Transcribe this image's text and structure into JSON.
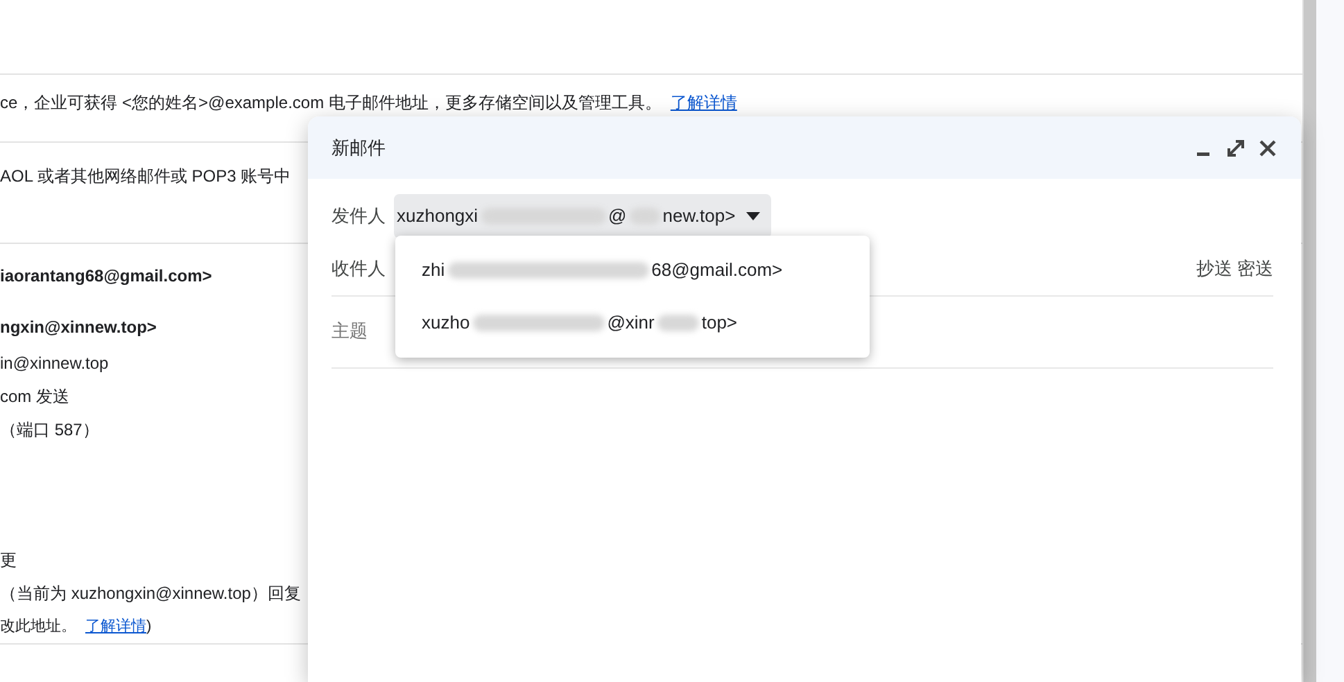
{
  "background_rows": [
    {
      "kind": "text",
      "text": "ce，企业可获得 <您的姓名>@example.com 电子邮件地址，更多存储空间以及管理工具。",
      "link": "了解详情",
      "divider": true
    },
    {
      "kind": "text",
      "text": "AOL 或者其他网络邮件或 POP3 账号中",
      "divider": true
    },
    {
      "kind": "bold",
      "text": "iaorantang68@gmail.com>"
    },
    {
      "kind": "bold",
      "text": "ngxin@xinnew.top>"
    },
    {
      "kind": "text",
      "text": "in@xinnew.top"
    },
    {
      "kind": "text",
      "text": "com 发送"
    },
    {
      "kind": "text",
      "text": "（端口 587）"
    },
    {
      "kind": "gap"
    },
    {
      "kind": "text",
      "text": "更"
    },
    {
      "kind": "text",
      "text": "（当前为 xuzhongxin@xinnew.top）回复"
    },
    {
      "kind": "small",
      "text": "改此地址。",
      "link": "了解详情",
      "after": ")",
      "divider": true
    }
  ],
  "compose": {
    "title": "新邮件",
    "from_label": "发件人",
    "from_parts": [
      "xuzhongxi",
      "@",
      "new.top>"
    ],
    "to_label": "收件人",
    "cc_bcc": "抄送 密送",
    "subject_placeholder": "主题",
    "dropdown": {
      "open": true,
      "items": [
        {
          "parts": [
            "zhi",
            "68@gmail.com>"
          ]
        },
        {
          "parts": [
            "xuzho",
            "@xinr",
            "top>"
          ]
        }
      ]
    }
  }
}
